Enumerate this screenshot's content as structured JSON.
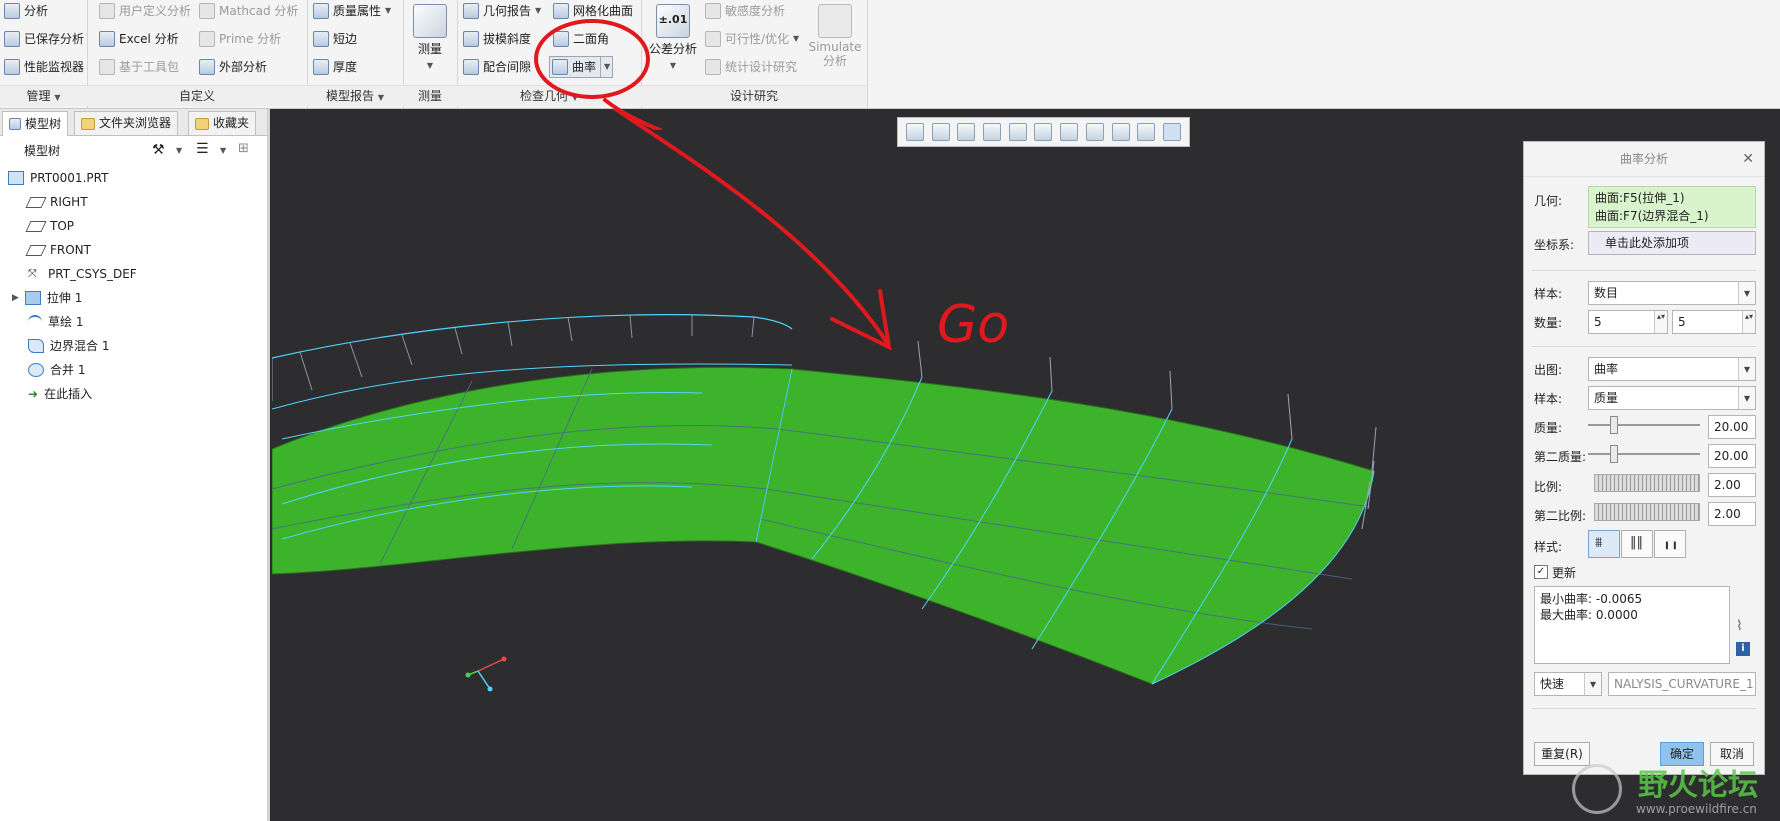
{
  "ribbon": {
    "manage": {
      "items": [
        "分析",
        "已保存分析",
        "性能监视器"
      ],
      "group_label": "管理"
    },
    "custom": {
      "col1": [
        "用户定义分析",
        "Excel 分析",
        "基于工具包"
      ],
      "col2": [
        "Mathcad 分析",
        "Prime 分析",
        "外部分析"
      ],
      "group_label": "自定义"
    },
    "model_report": {
      "items": [
        "质量属性",
        "短边",
        "厚度"
      ],
      "group_label": "模型报告"
    },
    "measure": {
      "button_label": "测量",
      "group_label": "测量"
    },
    "inspect": {
      "col1": [
        "几何报告",
        "拔模斜度",
        "配合间隙"
      ],
      "col2": [
        "网格化曲面",
        "二面角",
        "曲率"
      ],
      "group_label": "检查几何"
    },
    "design_study": {
      "tolerance_icon_text": "±.01",
      "tolerance_label": "公差分析",
      "col2": [
        "敏感度分析",
        "可行性/优化",
        "统计设计研究"
      ],
      "simulate_label": "Simulate\n分析",
      "group_label": "设计研究"
    }
  },
  "left_panel": {
    "tabs": [
      "模型树",
      "文件夹浏览器",
      "收藏夹"
    ],
    "tree_title": "模型树",
    "tree_items": [
      "PRT0001.PRT",
      "RIGHT",
      "TOP",
      "FRONT",
      "PRT_CSYS_DEF",
      "拉伸 1",
      "草绘 1",
      "边界混合 1",
      "合并 1",
      "在此插入"
    ]
  },
  "annotation": {
    "text": "Go",
    "color": "#e0191e"
  },
  "dialog": {
    "title": "曲率分析",
    "geometry_label": "几何:",
    "geometry_items": [
      "曲面:F5(拉伸_1)",
      "曲面:F7(边界混合_1)"
    ],
    "csys_label": "坐标系:",
    "csys_placeholder": "单击此处添加项",
    "sample_label": "样本:",
    "sample_value": "数目",
    "count_label": "数量:",
    "count_u": "5",
    "count_v": "5",
    "output_label": "出图:",
    "output_value": "曲率",
    "sample2_label": "样本:",
    "sample2_value": "质量",
    "quality_label": "质量:",
    "quality_value": "20.00",
    "quality2_label": "第二质量:",
    "quality2_value": "20.00",
    "scale_label": "比例:",
    "scale_value": "2.00",
    "scale2_label": "第二比例:",
    "scale2_value": "2.00",
    "style_label": "样式:",
    "update_label": "更新",
    "update_checked": true,
    "result_min": "最小曲率: -0.0065",
    "result_max": "最大曲率: 0.0000",
    "mode_value": "快速",
    "name_value": "NALYSIS_CURVATURE_1",
    "repeat_button": "重复(R)",
    "ok_button": "确定",
    "cancel_button": "取消"
  },
  "watermark": {
    "text_cn": "野火论坛",
    "text_url": "www.proewildfire.cn"
  },
  "colors": {
    "surface_green": "#3cb32a",
    "curve_cyan": "#4fd4ff",
    "viewport_bg": "#2d2d30",
    "annotation_red": "#e0191e"
  }
}
